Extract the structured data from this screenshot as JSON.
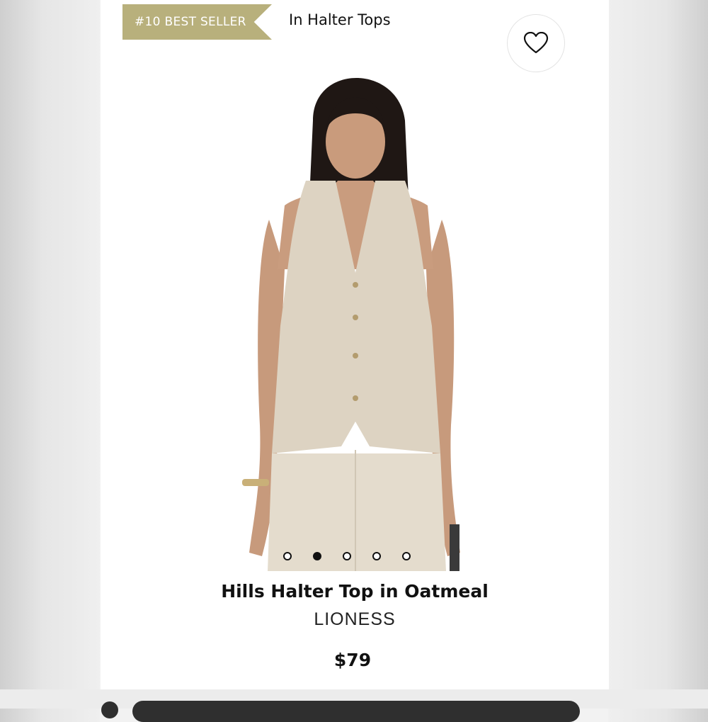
{
  "badge": {
    "label": "#10 BEST SELLER",
    "color": "#b8b07c"
  },
  "category": {
    "label": "In Halter Tops"
  },
  "favorite": {
    "icon": "heart-icon"
  },
  "carousel": {
    "count": 5,
    "active_index": 1
  },
  "product": {
    "title": "Hills Halter Top in Oatmeal",
    "brand": "LIONESS",
    "price": "$79"
  }
}
